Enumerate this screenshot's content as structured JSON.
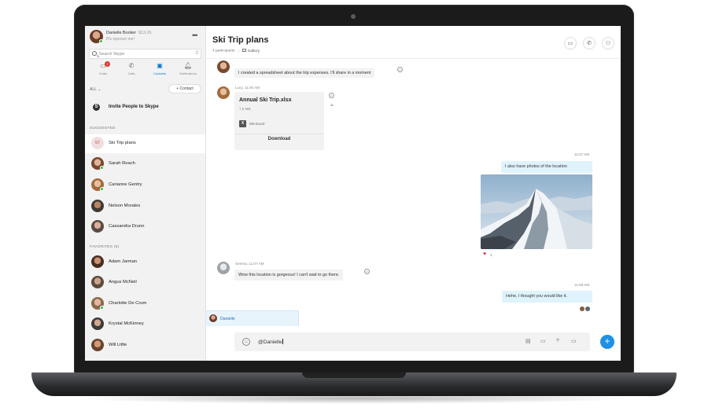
{
  "profile": {
    "name": "Danielle Booker",
    "credit": "$13.26",
    "status": "Pls sponsor me!"
  },
  "search": {
    "placeholder": "Search Skype"
  },
  "nav_tabs": [
    {
      "label": "Chats",
      "badge": "2"
    },
    {
      "label": "Calls"
    },
    {
      "label": "Contacts"
    },
    {
      "label": "Notifications"
    }
  ],
  "contacts_filter": "ALL",
  "add_contact_label": "+ Contact",
  "invite_label": "Invite People to Skype",
  "suggested_heading": "SUGGESTED",
  "suggested": [
    {
      "name": "Ski Trip plans",
      "initials": "ST"
    },
    {
      "name": "Sarah Roach"
    },
    {
      "name": "Carianne Gentry"
    },
    {
      "name": "Nelson Morales"
    },
    {
      "name": "Cassandra Drunn"
    }
  ],
  "favorites_heading": "FAVORITES (5)",
  "favorites": [
    {
      "name": "Adam Jarman"
    },
    {
      "name": "Angus McNeil"
    },
    {
      "name": "Charlotte De Crum"
    },
    {
      "name": "Krystal McKinney"
    },
    {
      "name": "Will Little"
    }
  ],
  "chat": {
    "title": "Ski Trip plans",
    "participants": "4 participants",
    "gallery": "Gallery",
    "messages": {
      "m1_text": "I created a spreadsheet about the trip expenses. I'll share in a moment",
      "m2_sender": "Lucy, 11:00 AM",
      "file_name": "Annual Ski Trip.xlsx",
      "file_size": "7,6 MB",
      "file_type": "MS Excel",
      "download": "Download",
      "t1": "11:07 AM",
      "m3_text": "I also have photos of the location",
      "heart_count": "1",
      "m4_sender": "Serena, 11:07 AM",
      "m4_text": "Wow this location is gorgeous! I can't wait to go there.",
      "t2": "11:08 AM",
      "m5_text": "Hehe, I thought you would like it."
    },
    "mention_suggestion": "Danielle",
    "compose_value": "@Danielle"
  },
  "colors": {
    "accent": "#0078d4",
    "send": "#1e90e6",
    "my_bubble": "#dff3fd",
    "sidebar": "#f2f2f2"
  }
}
